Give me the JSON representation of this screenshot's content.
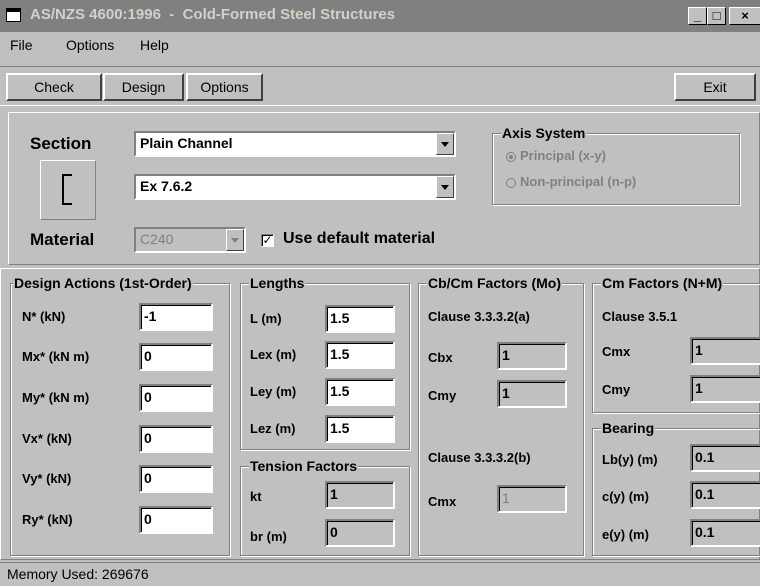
{
  "window": {
    "title": "AS/NZS 4600:1996  -  Cold-Formed Steel Structures",
    "minimize_glyph": "_",
    "maximize_glyph": "□",
    "close_glyph": "×"
  },
  "menu": {
    "file": "File",
    "options": "Options",
    "help": "Help"
  },
  "toolbar": {
    "check": "Check",
    "design": "Design",
    "options": "Options",
    "exit": "Exit"
  },
  "section": {
    "label": "Section",
    "type_value": "Plain Channel",
    "size_value": "Ex 7.6.2",
    "icon": "channel-section-icon"
  },
  "material": {
    "label": "Material",
    "value": "C240",
    "use_default_label": "Use default material",
    "use_default_checked": true
  },
  "axis_system": {
    "title": "Axis System",
    "principal": "Principal (x-y)",
    "non_principal": "Non-principal (n-p)",
    "selected": "principal"
  },
  "design_actions": {
    "title": "Design Actions (1st-Order)",
    "fields": [
      {
        "label": "N* (kN)",
        "value": "-1"
      },
      {
        "label": "Mx* (kN m)",
        "value": "0"
      },
      {
        "label": "My* (kN m)",
        "value": "0"
      },
      {
        "label": "Vx* (kN)",
        "value": "0"
      },
      {
        "label": "Vy* (kN)",
        "value": "0"
      },
      {
        "label": "Ry* (kN)",
        "value": "0"
      }
    ]
  },
  "lengths": {
    "title": "Lengths",
    "fields": [
      {
        "label": "L (m)",
        "value": "1.5"
      },
      {
        "label": "Lex (m)",
        "value": "1.5"
      },
      {
        "label": "Ley (m)",
        "value": "1.5"
      },
      {
        "label": "Lez (m)",
        "value": "1.5"
      }
    ]
  },
  "tension": {
    "title": "Tension Factors",
    "fields": [
      {
        "label": "kt",
        "value": "1"
      },
      {
        "label": "br (m)",
        "value": "0"
      }
    ]
  },
  "cbcm": {
    "title": "Cb/Cm Factors (Mo)",
    "clause_a": "Clause 3.3.3.2(a)",
    "cbx_label": "Cbx",
    "cbx_value": "1",
    "cmy_label": "Cmy",
    "cmy_value": "1",
    "clause_b": "Clause 3.3.3.2(b)",
    "cmx_label": "Cmx",
    "cmx_value": "1"
  },
  "cm_nm": {
    "title": "Cm Factors (N+M)",
    "clause": "Clause 3.5.1",
    "cmx_label": "Cmx",
    "cmx_value": "1",
    "cmy_label": "Cmy",
    "cmy_value": "1"
  },
  "bearing": {
    "title": "Bearing",
    "fields": [
      {
        "label": "Lb(y) (m)",
        "value": "0.1"
      },
      {
        "label": "c(y) (m)",
        "value": "0.1"
      },
      {
        "label": "e(y) (m)",
        "value": "0.1"
      }
    ]
  },
  "status": {
    "memory": "Memory Used: 269676"
  }
}
